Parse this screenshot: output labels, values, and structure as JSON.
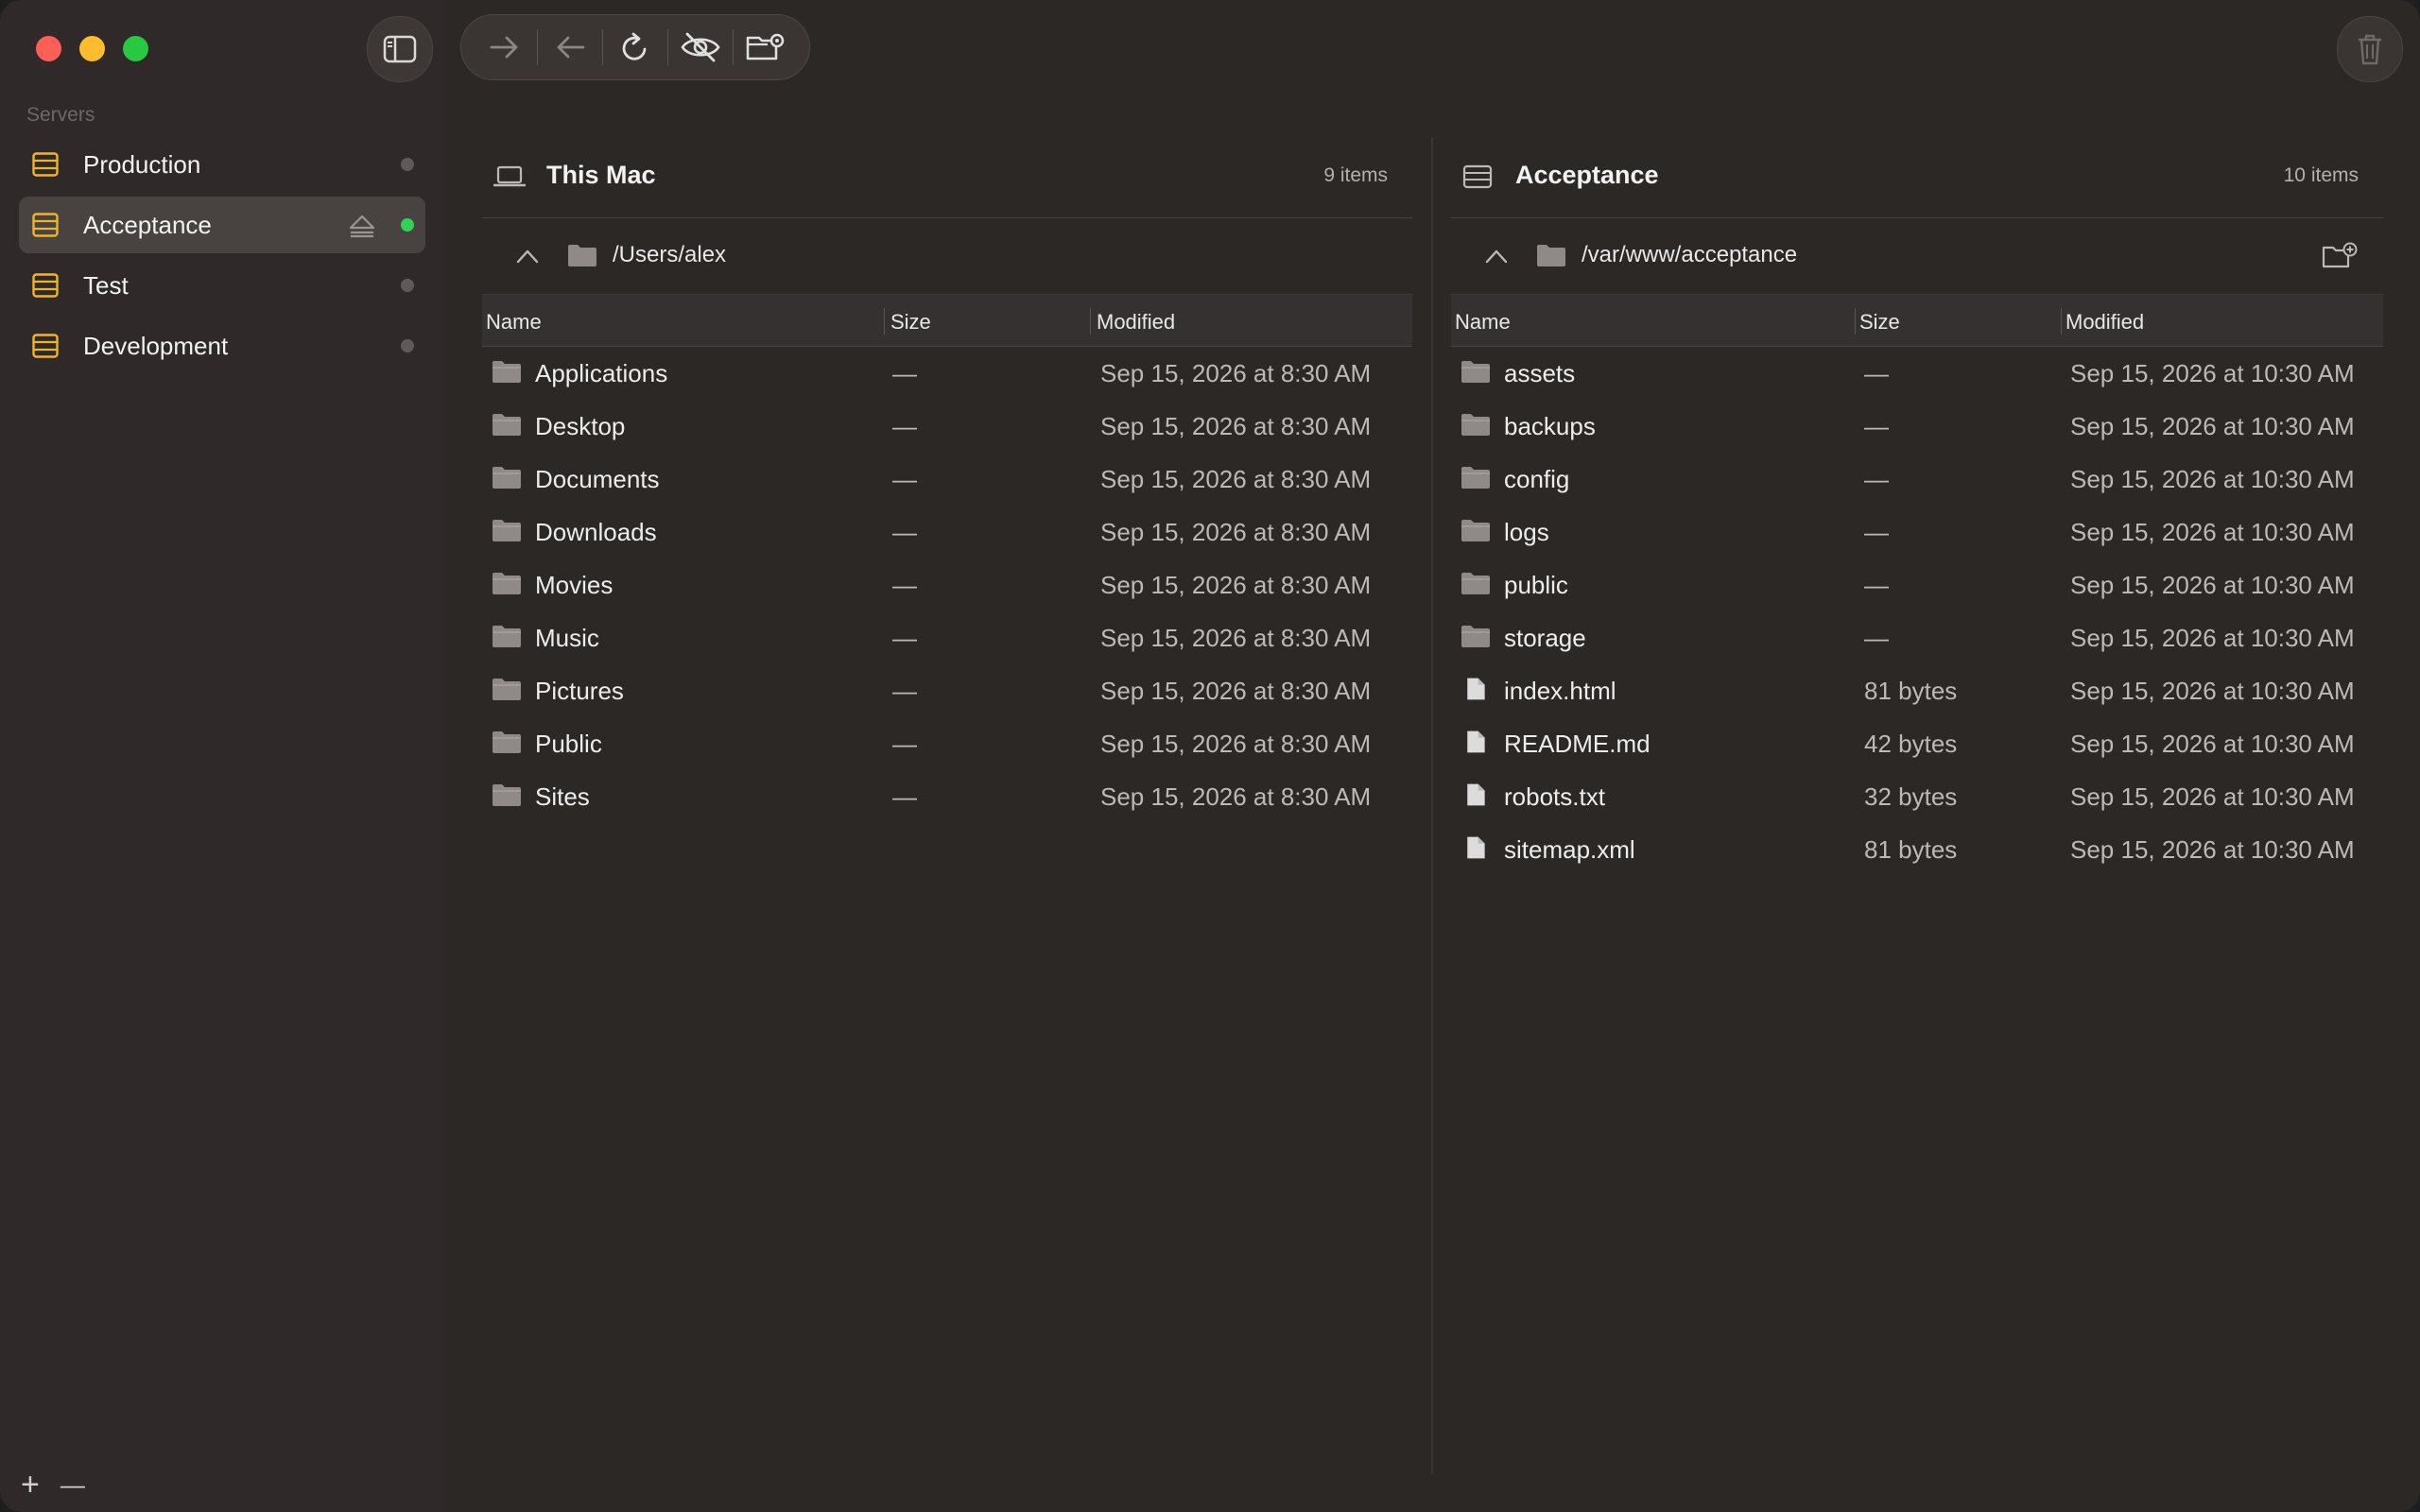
{
  "sidebar": {
    "section_label": "Servers",
    "servers": [
      {
        "label": "Production",
        "status": "offline",
        "active": false
      },
      {
        "label": "Acceptance",
        "status": "online",
        "active": true
      },
      {
        "label": "Test",
        "status": "offline",
        "active": false
      },
      {
        "label": "Development",
        "status": "offline",
        "active": false
      }
    ],
    "footer": {
      "add": "+",
      "remove": "—"
    }
  },
  "colors": {
    "server_icon": "#f0b429",
    "online": "#31d158",
    "offline": "#5e5a58"
  },
  "toolbar": {
    "icons": [
      "forward-arrow-icon",
      "back-arrow-icon",
      "refresh-icon",
      "hidden-files-icon",
      "folder-settings-icon"
    ]
  },
  "left_pane": {
    "title": "This Mac",
    "count": "9 items",
    "path": "/Users/alex",
    "columns": {
      "name": "Name",
      "size": "Size",
      "modified": "Modified"
    },
    "rows": [
      {
        "name": "Applications",
        "size": "—",
        "modified": "Sep 15, 2026 at 8:30 AM",
        "type": "folder"
      },
      {
        "name": "Desktop",
        "size": "—",
        "modified": "Sep 15, 2026 at 8:30 AM",
        "type": "folder"
      },
      {
        "name": "Documents",
        "size": "—",
        "modified": "Sep 15, 2026 at 8:30 AM",
        "type": "folder"
      },
      {
        "name": "Downloads",
        "size": "—",
        "modified": "Sep 15, 2026 at 8:30 AM",
        "type": "folder"
      },
      {
        "name": "Movies",
        "size": "—",
        "modified": "Sep 15, 2026 at 8:30 AM",
        "type": "folder"
      },
      {
        "name": "Music",
        "size": "—",
        "modified": "Sep 15, 2026 at 8:30 AM",
        "type": "folder"
      },
      {
        "name": "Pictures",
        "size": "—",
        "modified": "Sep 15, 2026 at 8:30 AM",
        "type": "folder"
      },
      {
        "name": "Public",
        "size": "—",
        "modified": "Sep 15, 2026 at 8:30 AM",
        "type": "folder"
      },
      {
        "name": "Sites",
        "size": "—",
        "modified": "Sep 15, 2026 at 8:30 AM",
        "type": "folder"
      }
    ]
  },
  "right_pane": {
    "title": "Acceptance",
    "count": "10 items",
    "path": "/var/www/acceptance",
    "columns": {
      "name": "Name",
      "size": "Size",
      "modified": "Modified"
    },
    "rows": [
      {
        "name": "assets",
        "size": "—",
        "modified": "Sep 15, 2026 at 10:30 AM",
        "type": "folder"
      },
      {
        "name": "backups",
        "size": "—",
        "modified": "Sep 15, 2026 at 10:30 AM",
        "type": "folder"
      },
      {
        "name": "config",
        "size": "—",
        "modified": "Sep 15, 2026 at 10:30 AM",
        "type": "folder"
      },
      {
        "name": "logs",
        "size": "—",
        "modified": "Sep 15, 2026 at 10:30 AM",
        "type": "folder"
      },
      {
        "name": "public",
        "size": "—",
        "modified": "Sep 15, 2026 at 10:30 AM",
        "type": "folder"
      },
      {
        "name": "storage",
        "size": "—",
        "modified": "Sep 15, 2026 at 10:30 AM",
        "type": "folder"
      },
      {
        "name": "index.html",
        "size": "81 bytes",
        "modified": "Sep 15, 2026 at 10:30 AM",
        "type": "file"
      },
      {
        "name": "README.md",
        "size": "42 bytes",
        "modified": "Sep 15, 2026 at 10:30 AM",
        "type": "file"
      },
      {
        "name": "robots.txt",
        "size": "32 bytes",
        "modified": "Sep 15, 2026 at 10:30 AM",
        "type": "file"
      },
      {
        "name": "sitemap.xml",
        "size": "81 bytes",
        "modified": "Sep 15, 2026 at 10:30 AM",
        "type": "file"
      }
    ]
  }
}
